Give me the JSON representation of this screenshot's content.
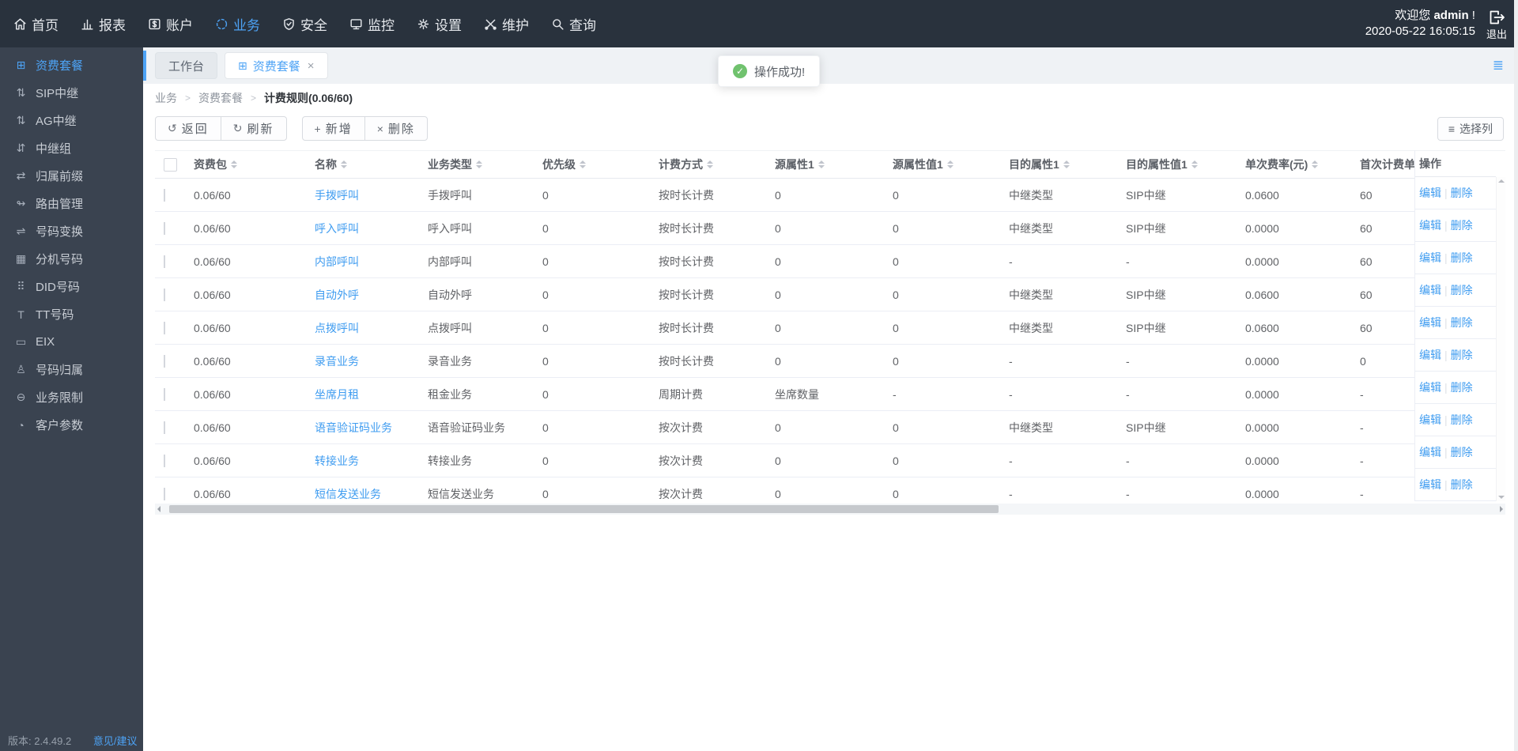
{
  "accent_color": "#4da3f5",
  "navbar": {
    "items": [
      {
        "label": "首页"
      },
      {
        "label": "报表"
      },
      {
        "label": "账户"
      },
      {
        "label": "业务"
      },
      {
        "label": "安全"
      },
      {
        "label": "监控"
      },
      {
        "label": "设置"
      },
      {
        "label": "维护"
      },
      {
        "label": "查询"
      }
    ],
    "active_item": "业务",
    "welcome_prefix": "欢迎您 ",
    "username": "admin",
    "welcome_suffix": " !",
    "datetime": "2020-05-22 16:05:15",
    "logout_label": "退出"
  },
  "sidebar": {
    "items": [
      {
        "label": "资费套餐",
        "glyph": "⊞",
        "active": true
      },
      {
        "label": "SIP中继",
        "glyph": "⇅",
        "active": false
      },
      {
        "label": "AG中继",
        "glyph": "⇅",
        "active": false
      },
      {
        "label": "中继组",
        "glyph": "⇵",
        "active": false
      },
      {
        "label": "归属前缀",
        "glyph": "⇄",
        "active": false
      },
      {
        "label": "路由管理",
        "glyph": "↬",
        "active": false
      },
      {
        "label": "号码变换",
        "glyph": "⇌",
        "active": false
      },
      {
        "label": "分机号码",
        "glyph": "▦",
        "active": false
      },
      {
        "label": "DID号码",
        "glyph": "⠿",
        "active": false
      },
      {
        "label": "TT号码",
        "glyph": "T",
        "active": false
      },
      {
        "label": "EIX",
        "glyph": "▭",
        "active": false
      },
      {
        "label": "号码归属",
        "glyph": "♙",
        "active": false
      },
      {
        "label": "业务限制",
        "glyph": "⊖",
        "active": false
      },
      {
        "label": "客户参数",
        "glyph": "◔",
        "active": false
      }
    ],
    "footer": {
      "version": "版本: 2.4.49.2",
      "feedback": "意见/建议"
    }
  },
  "tabs": [
    {
      "label": "工作台",
      "active": false
    },
    {
      "label": "资费套餐",
      "active": true
    }
  ],
  "toast": {
    "message": "操作成功!"
  },
  "breadcrumb": [
    "业务",
    "资费套餐",
    "计费规则(0.06/60)"
  ],
  "toolbar": {
    "back": "返回",
    "refresh": "刷新",
    "add": "新增",
    "delete": "删除",
    "column_select": "选择列"
  },
  "table": {
    "columns": [
      {
        "label": "资费包",
        "sortable": true
      },
      {
        "label": "名称",
        "sortable": true
      },
      {
        "label": "业务类型",
        "sortable": true
      },
      {
        "label": "优先级",
        "sortable": true
      },
      {
        "label": "计费方式",
        "sortable": true
      },
      {
        "label": "源属性1",
        "sortable": true
      },
      {
        "label": "源属性值1",
        "sortable": true
      },
      {
        "label": "目的属性1",
        "sortable": true
      },
      {
        "label": "目的属性值1",
        "sortable": true
      },
      {
        "label": "单次费率(元)",
        "sortable": true
      },
      {
        "label": "首次计费单",
        "sortable": false
      }
    ],
    "ops_label": "操作",
    "ops": [
      "编辑",
      "删除"
    ],
    "rows": [
      {
        "cells": [
          "0.06/60",
          "手拨呼叫",
          "手拨呼叫",
          "0",
          "按时长计费",
          "0",
          "0",
          "中继类型",
          "SIP中继",
          "0.0600",
          "60"
        ]
      },
      {
        "cells": [
          "0.06/60",
          "呼入呼叫",
          "呼入呼叫",
          "0",
          "按时长计费",
          "0",
          "0",
          "中继类型",
          "SIP中继",
          "0.0000",
          "60"
        ]
      },
      {
        "cells": [
          "0.06/60",
          "内部呼叫",
          "内部呼叫",
          "0",
          "按时长计费",
          "0",
          "0",
          "-",
          "-",
          "0.0000",
          "60"
        ]
      },
      {
        "cells": [
          "0.06/60",
          "自动外呼",
          "自动外呼",
          "0",
          "按时长计费",
          "0",
          "0",
          "中继类型",
          "SIP中继",
          "0.0600",
          "60"
        ]
      },
      {
        "cells": [
          "0.06/60",
          "点拨呼叫",
          "点拨呼叫",
          "0",
          "按时长计费",
          "0",
          "0",
          "中继类型",
          "SIP中继",
          "0.0600",
          "60"
        ]
      },
      {
        "cells": [
          "0.06/60",
          "录音业务",
          "录音业务",
          "0",
          "按时长计费",
          "0",
          "0",
          "-",
          "-",
          "0.0000",
          "0"
        ]
      },
      {
        "cells": [
          "0.06/60",
          "坐席月租",
          "租金业务",
          "0",
          "周期计费",
          "坐席数量",
          "-",
          "-",
          "-",
          "0.0000",
          "-"
        ]
      },
      {
        "cells": [
          "0.06/60",
          "语音验证码业务",
          "语音验证码业务",
          "0",
          "按次计费",
          "0",
          "0",
          "中继类型",
          "SIP中继",
          "0.0000",
          "-"
        ]
      },
      {
        "cells": [
          "0.06/60",
          "转接业务",
          "转接业务",
          "0",
          "按次计费",
          "0",
          "0",
          "-",
          "-",
          "0.0000",
          "-"
        ]
      },
      {
        "cells": [
          "0.06/60",
          "短信发送业务",
          "短信发送业务",
          "0",
          "按次计费",
          "0",
          "0",
          "-",
          "-",
          "0.0000",
          "-"
        ]
      }
    ]
  }
}
